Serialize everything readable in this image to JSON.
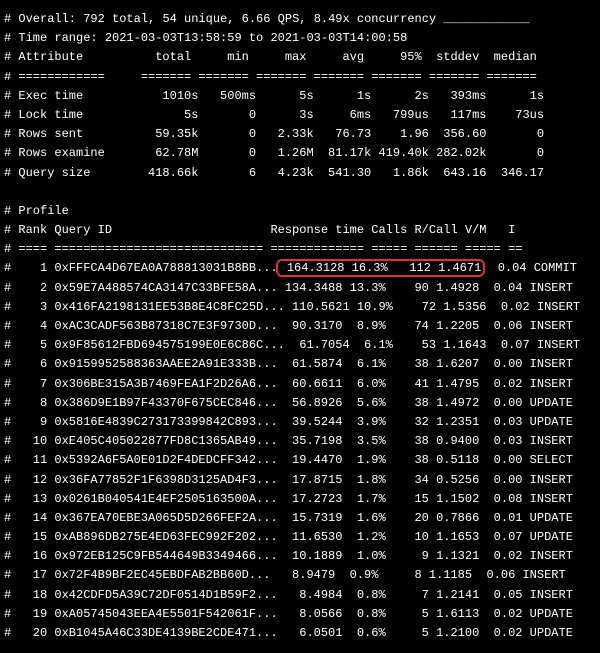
{
  "overall": {
    "total": "792",
    "unique": "54",
    "qps": "6.66",
    "concurrency": "8.49x"
  },
  "time_range": "2021-03-03T13:58:59 to 2021-03-03T14:00:58",
  "headers": {
    "attr": "Attribute",
    "total": "total",
    "min": "min",
    "max": "max",
    "avg": "avg",
    "p95": "95%",
    "stddev": "stddev",
    "median": "median"
  },
  "attrs": [
    {
      "name": "Exec time",
      "total": "1010s",
      "min": "500ms",
      "max": "5s",
      "avg": "1s",
      "p95": "2s",
      "stddev": "393ms",
      "median": "1s"
    },
    {
      "name": "Lock time",
      "total": "5s",
      "min": "0",
      "max": "3s",
      "avg": "6ms",
      "p95": "799us",
      "stddev": "117ms",
      "median": "73us"
    },
    {
      "name": "Rows sent",
      "total": "59.35k",
      "min": "0",
      "max": "2.33k",
      "avg": "76.73",
      "p95": "1.96",
      "stddev": "356.60",
      "median": "0"
    },
    {
      "name": "Rows examine",
      "total": "62.78M",
      "min": "0",
      "max": "1.26M",
      "avg": "81.17k",
      "p95": "419.40k",
      "stddev": "282.02k",
      "median": "0"
    },
    {
      "name": "Query size",
      "total": "418.66k",
      "min": "6",
      "max": "4.23k",
      "avg": "541.30",
      "p95": "1.86k",
      "stddev": "643.16",
      "median": "346.17"
    }
  ],
  "profile_label": "Profile",
  "profile_headers": {
    "rank": "Rank",
    "qid": "Query ID",
    "rt": "Response time",
    "calls": "Calls",
    "rcall": "R/Call",
    "vm": "V/M",
    "item": "I"
  },
  "rows": [
    {
      "r": "1",
      "id": "0xFFFCA4D67EA0A788813031B8BB...",
      "rt": "164.3128",
      "pct": "16.3%",
      "calls": "112",
      "rcall": "1.4671",
      "vm": "0.04",
      "item": "COMMIT",
      "hl": true
    },
    {
      "r": "2",
      "id": "0x59E7A488574CA3147C33BFE58A...",
      "rt": "134.3488",
      "pct": "13.3%",
      "calls": "90",
      "rcall": "1.4928",
      "vm": "0.04",
      "item": "INSERT"
    },
    {
      "r": "3",
      "id": "0x416FA2198131EE53B8E4C8FC25D...",
      "rt": "110.5621",
      "pct": "10.9%",
      "calls": "72",
      "rcall": "1.5356",
      "vm": "0.02",
      "item": "INSERT"
    },
    {
      "r": "4",
      "id": "0xAC3CADF563B87318C7E3F9730D...",
      "rt": "90.3170",
      "pct": "8.9%",
      "calls": "74",
      "rcall": "1.2205",
      "vm": "0.06",
      "item": "INSERT"
    },
    {
      "r": "5",
      "id": "0x9F85612FBD694575199E0E6C86C...",
      "rt": "61.7054",
      "pct": "6.1%",
      "calls": "53",
      "rcall": "1.1643",
      "vm": "0.07",
      "item": "INSERT"
    },
    {
      "r": "6",
      "id": "0x9159952588363AAEE2A91E333B...",
      "rt": "61.5874",
      "pct": "6.1%",
      "calls": "38",
      "rcall": "1.6207",
      "vm": "0.00",
      "item": "INSERT"
    },
    {
      "r": "7",
      "id": "0x306BE315A3B7469FEA1F2D26A6...",
      "rt": "60.6611",
      "pct": "6.0%",
      "calls": "41",
      "rcall": "1.4795",
      "vm": "0.02",
      "item": "INSERT"
    },
    {
      "r": "8",
      "id": "0x386D9E1B97F43370F675CEC846...",
      "rt": "56.8926",
      "pct": "5.6%",
      "calls": "38",
      "rcall": "1.4972",
      "vm": "0.00",
      "item": "UPDATE"
    },
    {
      "r": "9",
      "id": "0x5816E4839C273173399842C893...",
      "rt": "39.5244",
      "pct": "3.9%",
      "calls": "32",
      "rcall": "1.2351",
      "vm": "0.03",
      "item": "UPDATE"
    },
    {
      "r": "10",
      "id": "0xE405C405022877FD8C1365AB49...",
      "rt": "35.7198",
      "pct": "3.5%",
      "calls": "38",
      "rcall": "0.9400",
      "vm": "0.03",
      "item": "INSERT"
    },
    {
      "r": "11",
      "id": "0x5392A6F5A0E01D2F4DEDCFF342...",
      "rt": "19.4470",
      "pct": "1.9%",
      "calls": "38",
      "rcall": "0.5118",
      "vm": "0.00",
      "item": "SELECT"
    },
    {
      "r": "12",
      "id": "0x36FA77852F1F6398D3125AD4F3...",
      "rt": "17.8715",
      "pct": "1.8%",
      "calls": "34",
      "rcall": "0.5256",
      "vm": "0.00",
      "item": "INSERT"
    },
    {
      "r": "13",
      "id": "0x0261B040541E4EF2505163500A...",
      "rt": "17.2723",
      "pct": "1.7%",
      "calls": "15",
      "rcall": "1.1502",
      "vm": "0.08",
      "item": "INSERT"
    },
    {
      "r": "14",
      "id": "0x367EA70EBE3A065D5D266FEF2A...",
      "rt": "15.7319",
      "pct": "1.6%",
      "calls": "20",
      "rcall": "0.7866",
      "vm": "0.01",
      "item": "UPDATE"
    },
    {
      "r": "15",
      "id": "0xAB896DB275E4ED63FEC992F202...",
      "rt": "11.6530",
      "pct": "1.2%",
      "calls": "10",
      "rcall": "1.1653",
      "vm": "0.07",
      "item": "UPDATE"
    },
    {
      "r": "16",
      "id": "0x972EB125C9FB544649B3349466...",
      "rt": "10.1889",
      "pct": "1.0%",
      "calls": "9",
      "rcall": "1.1321",
      "vm": "0.02",
      "item": "INSERT"
    },
    {
      "r": "17",
      "id": "0x72F4B9BF2EC45EBDFAB2BB60D...",
      "rt": "8.9479",
      "pct": "0.9%",
      "calls": "8",
      "rcall": "1.1185",
      "vm": "0.06",
      "item": "INSERT"
    },
    {
      "r": "18",
      "id": "0x42CDFD5A39C72DF0514D1B59F2...",
      "rt": "8.4984",
      "pct": "0.8%",
      "calls": "7",
      "rcall": "1.2141",
      "vm": "0.05",
      "item": "INSERT"
    },
    {
      "r": "19",
      "id": "0xA05745043EEA4E5501F542061F...",
      "rt": "8.0566",
      "pct": "0.8%",
      "calls": "5",
      "rcall": "1.6113",
      "vm": "0.02",
      "item": "UPDATE"
    },
    {
      "r": "20",
      "id": "0xB1045A46C33DE4139BE2CDE471...",
      "rt": "6.0501",
      "pct": "0.6%",
      "calls": "5",
      "rcall": "1.2100",
      "vm": "0.02",
      "item": "UPDATE"
    }
  ]
}
